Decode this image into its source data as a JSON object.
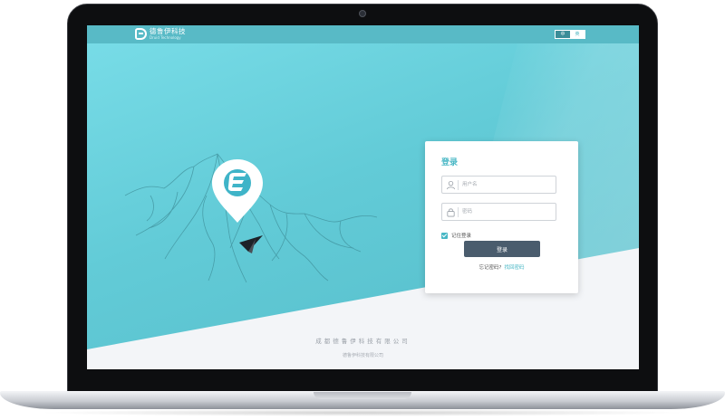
{
  "header": {
    "logo_cn": "德鲁伊科技",
    "logo_en": "Druid Technology",
    "lang_zh": "中",
    "lang_en": "英"
  },
  "login": {
    "title": "登录",
    "username_placeholder": "用户名",
    "password_placeholder": "密码",
    "remember_label": "记住登录",
    "remember_checked": true,
    "submit_label": "登录",
    "forgot_question": "忘记密码?",
    "forgot_link": "找回密码"
  },
  "footer": {
    "company": "成都德鲁伊科技有限公司",
    "copyright": "德鲁伊科技有限公司"
  },
  "colors": {
    "accent": "#48b7c5",
    "button": "#4a5c6d",
    "screen_bg": "#62cbd7"
  }
}
